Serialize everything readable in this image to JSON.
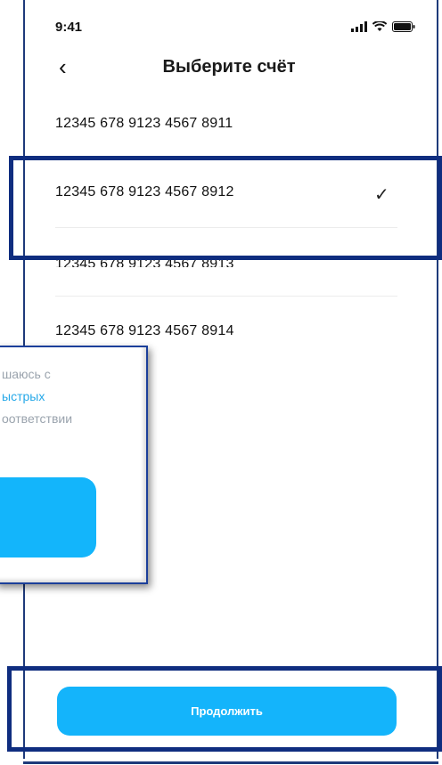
{
  "status_bar": {
    "time": "9:41"
  },
  "header": {
    "title": "Выберите счёт"
  },
  "accounts": [
    {
      "number": "12345 678 9123 4567 8911"
    },
    {
      "number": "12345 678 9123 4567 8912",
      "selected": true
    },
    {
      "number": "12345 678 9123 4567 8913"
    },
    {
      "number": "12345 678 9123 4567 8914"
    }
  ],
  "popup": {
    "line1": "шаюсь с",
    "line2": "ыстрых",
    "line3": "оответствии"
  },
  "footer": {
    "continue_label": "Продолжить"
  },
  "colors": {
    "accent": "#14b4fb",
    "highlight": "#0f2d7f",
    "link": "#25a8e8"
  },
  "icons": [
    "chevron-left-icon",
    "signal-icon",
    "wifi-icon",
    "battery-icon",
    "checkmark-icon"
  ]
}
